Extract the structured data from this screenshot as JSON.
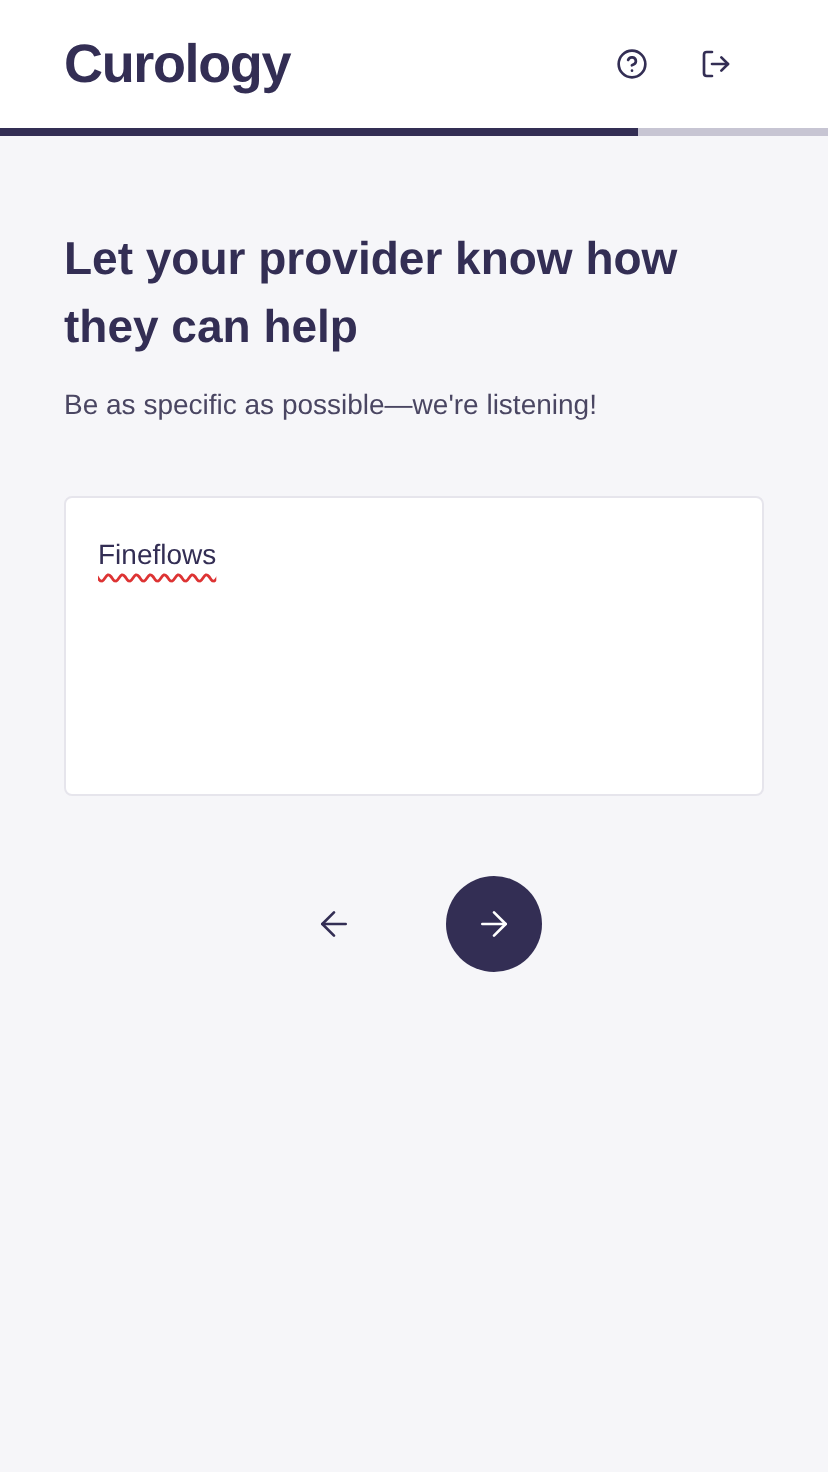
{
  "header": {
    "logo": "Curology"
  },
  "progress": {
    "level": 0.77
  },
  "question": {
    "title": "Let your provider know how they can help",
    "subtitle": "Be as specific as possible—we're listening!"
  },
  "answer": {
    "value": "Fineflows"
  }
}
